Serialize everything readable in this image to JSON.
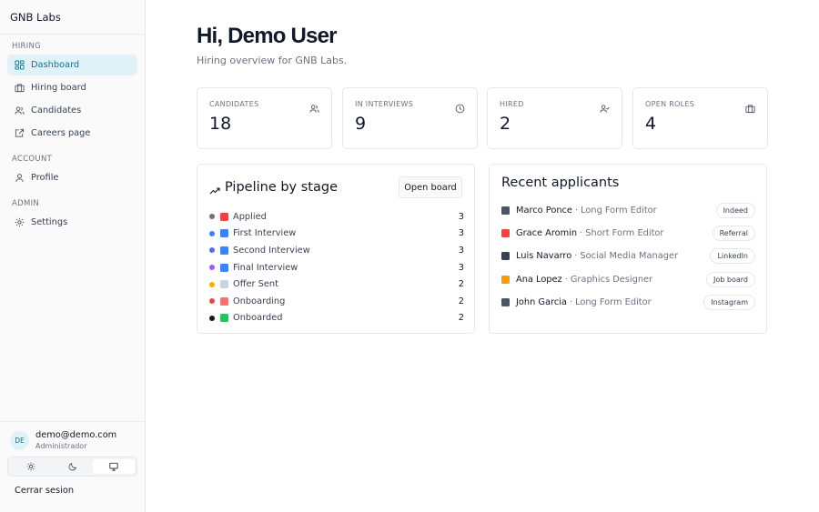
{
  "app": {
    "brand": "GNB Labs"
  },
  "sidebar": {
    "sections": [
      {
        "label": "HIRING",
        "items": [
          {
            "label": "Dashboard",
            "icon": "dashboard-icon",
            "active": true
          },
          {
            "label": "Hiring board",
            "icon": "briefcase-icon"
          },
          {
            "label": "Candidates",
            "icon": "users-icon"
          },
          {
            "label": "Careers page",
            "icon": "external-link-icon"
          }
        ]
      },
      {
        "label": "ACCOUNT",
        "items": [
          {
            "label": "Profile",
            "icon": "user-icon"
          }
        ]
      },
      {
        "label": "ADMIN",
        "items": [
          {
            "label": "Settings",
            "icon": "gear-icon"
          }
        ]
      }
    ],
    "user": {
      "initials": "DE",
      "email": "demo@demo.com",
      "role": "Administrador"
    },
    "theme": {
      "options": [
        "sun-icon",
        "moon-icon",
        "monitor-icon"
      ],
      "selected": "monitor-icon"
    },
    "signout": "Cerrar sesion"
  },
  "header": {
    "title": "Hi, Demo User",
    "subtitle": "Hiring overview for GNB Labs."
  },
  "stats": [
    {
      "label": "CANDIDATES",
      "value": "18",
      "icon": "users-icon"
    },
    {
      "label": "IN INTERVIEWS",
      "value": "9",
      "icon": "clock-icon"
    },
    {
      "label": "HIRED",
      "value": "2",
      "icon": "user-check-icon"
    },
    {
      "label": "OPEN ROLES",
      "value": "4",
      "icon": "briefcase-icon"
    }
  ],
  "pipeline": {
    "title": "Pipeline by stage",
    "button": "Open board",
    "stages": [
      {
        "label": "Applied",
        "count": "3",
        "dot": "#6b7280",
        "icon": "inbox-icon",
        "iconColor": "#ef4444"
      },
      {
        "label": "First Interview",
        "count": "3",
        "dot": "#3b82f6",
        "icon": "keycap-1-icon",
        "iconColor": "#3b82f6"
      },
      {
        "label": "Second Interview",
        "count": "3",
        "dot": "#6366f1",
        "icon": "keycap-2-icon",
        "iconColor": "#3b82f6"
      },
      {
        "label": "Final Interview",
        "count": "3",
        "dot": "#a855f7",
        "icon": "keycap-3-icon",
        "iconColor": "#3b82f6"
      },
      {
        "label": "Offer Sent",
        "count": "2",
        "dot": "#eab308",
        "icon": "envelope-icon",
        "iconColor": "#cbd5e1"
      },
      {
        "label": "Onboarding",
        "count": "2",
        "dot": "#ef4444",
        "icon": "rocket-icon",
        "iconColor": "#f87171"
      },
      {
        "label": "Onboarded",
        "count": "2",
        "dot": "#111827",
        "icon": "check-box-icon",
        "iconColor": "#22c55e"
      }
    ]
  },
  "recent": {
    "title": "Recent applicants",
    "applicants": [
      {
        "name": "Marco Ponce",
        "role": "Long Form Editor",
        "source": "Indeed",
        "icon": "clapper-icon",
        "iconColor": "#4b5563"
      },
      {
        "name": "Grace Aromin",
        "role": "Short Form Editor",
        "source": "Referral",
        "icon": "scissors-icon",
        "iconColor": "#ef4444"
      },
      {
        "name": "Luis Navarro",
        "role": "Social Media Manager",
        "source": "LinkedIn",
        "icon": "phone-icon",
        "iconColor": "#374151"
      },
      {
        "name": "Ana Lopez",
        "role": "Graphics Designer",
        "source": "Job board",
        "icon": "palette-icon",
        "iconColor": "#f59e0b"
      },
      {
        "name": "John Garcia",
        "role": "Long Form Editor",
        "source": "Instagram",
        "icon": "clapper-icon",
        "iconColor": "#4b5563"
      }
    ]
  }
}
